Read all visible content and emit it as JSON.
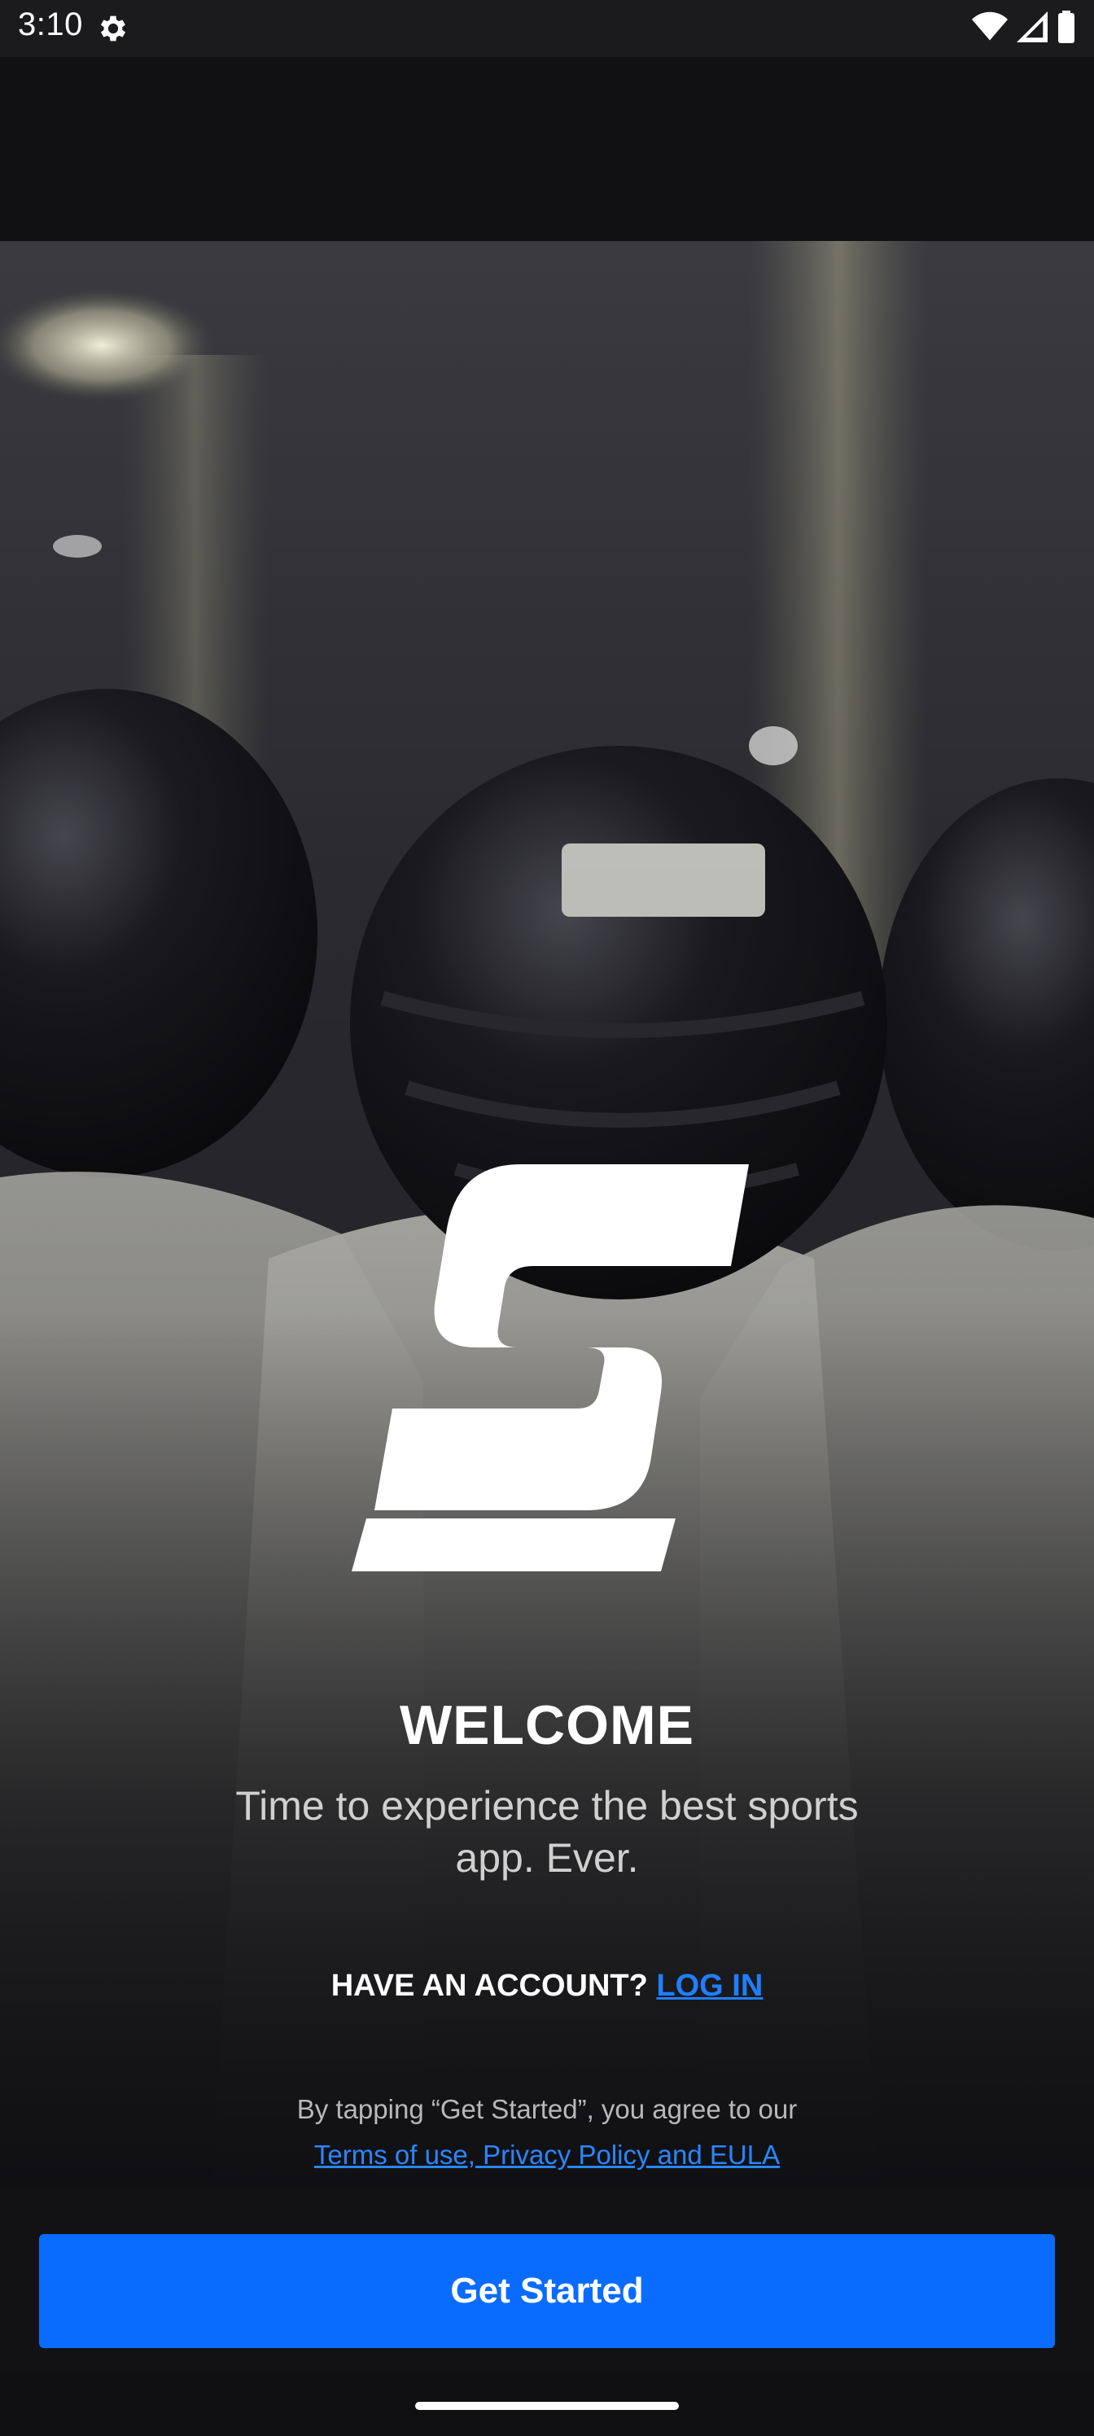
{
  "status_bar": {
    "time": "3:10",
    "icons": [
      "gear-icon",
      "wifi-icon",
      "cellular-signal-icon",
      "battery-icon"
    ]
  },
  "hero": {
    "background": "football-players-photo"
  },
  "logo": {
    "icon": "s-logo-icon"
  },
  "welcome": {
    "title": "WELCOME",
    "tagline": "Time to experience the best sports app. Ever."
  },
  "account": {
    "prompt": "HAVE AN ACCOUNT?",
    "login_label": "LOG IN"
  },
  "legal": {
    "agree_text": "By tapping “Get Started”, you agree to our",
    "terms_label": "Terms of use, Privacy Policy and EULA"
  },
  "cta": {
    "label": "Get Started"
  },
  "colors": {
    "accent": "#0a6cff",
    "link": "#1f7fff",
    "background": "#101012"
  }
}
